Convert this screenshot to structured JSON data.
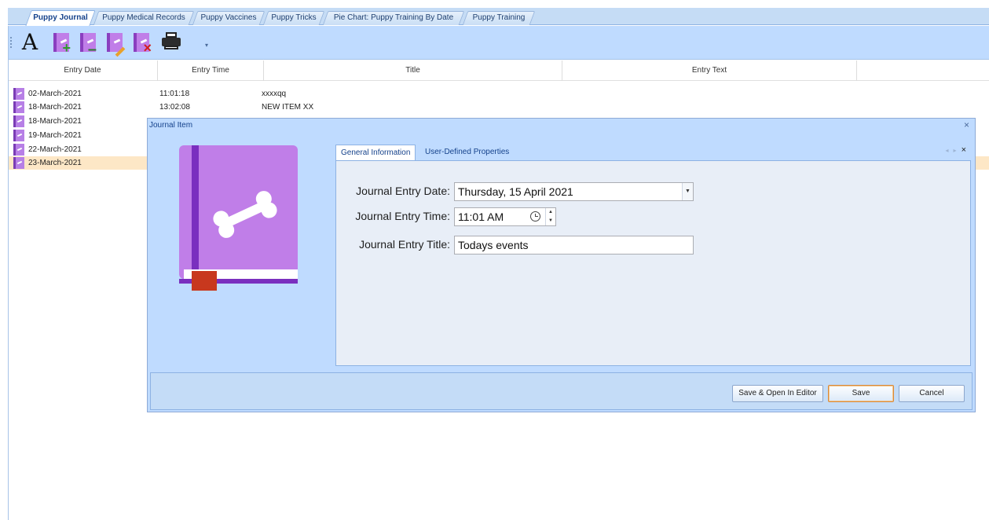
{
  "tabs": [
    {
      "label": "Puppy Journal",
      "active": true
    },
    {
      "label": "Puppy Medical Records",
      "active": false
    },
    {
      "label": "Puppy Vaccines",
      "active": false
    },
    {
      "label": "Puppy Tricks",
      "active": false
    },
    {
      "label": "Pie Chart: Puppy Training By Date",
      "active": false
    },
    {
      "label": "Puppy Training",
      "active": false
    }
  ],
  "toolbar": {
    "font_label": "A",
    "icons": [
      "font-icon",
      "add-journal-icon",
      "remove-journal-icon",
      "edit-journal-icon",
      "delete-journal-icon",
      "printer-icon"
    ]
  },
  "grid": {
    "columns": [
      "Entry Date",
      "Entry Time",
      "Title",
      "Entry Text"
    ],
    "rows": [
      {
        "date": "02-March-2021",
        "time": "11:01:18",
        "title": "xxxxqq",
        "text": ""
      },
      {
        "date": "18-March-2021",
        "time": "13:02:08",
        "title": "NEW ITEM XX",
        "text": ""
      },
      {
        "date": "18-March-2021",
        "time": "",
        "title": "",
        "text": ""
      },
      {
        "date": "19-March-2021",
        "time": "",
        "title": "",
        "text": ""
      },
      {
        "date": "22-March-2021",
        "time": "",
        "title": "",
        "text": ""
      },
      {
        "date": "23-March-2021",
        "time": "",
        "title": "",
        "text": "",
        "selected": true
      }
    ]
  },
  "dialog": {
    "title": "Journal Item",
    "close_glyph": "×",
    "tabs": [
      "General Information",
      "User-Defined Properties"
    ],
    "panel_nav": {
      "prev": "◂",
      "next": "▸",
      "close": "×"
    },
    "fields": {
      "date_label": "Journal Entry Date:",
      "date_value": "Thursday, 15 April 2021",
      "time_label": "Journal Entry Time:",
      "time_value": "11:01 AM",
      "title_label": "Journal Entry Title:",
      "title_value": "Todays events"
    },
    "buttons": {
      "save_open": "Save & Open In Editor",
      "save": "Save",
      "cancel": "Cancel"
    }
  },
  "colors": {
    "accent": "#bfdbff",
    "selected_row": "#fde7c6",
    "book_purple": "#c07ee8",
    "book_spine": "#7a2fbf",
    "bookmark": "#c8381e"
  }
}
